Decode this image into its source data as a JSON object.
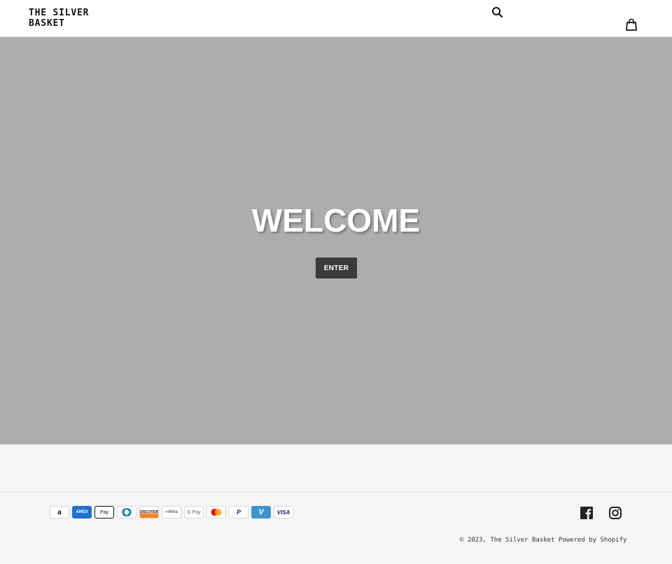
{
  "header": {
    "logo_line1": "THE SILVER",
    "logo_line2": "BASKET",
    "search_icon": "search-icon",
    "cart_icon": "cart-icon"
  },
  "hero": {
    "heading": "WELCOME",
    "button_label": "ENTER",
    "background_color": "#adadad"
  },
  "footer": {
    "payment_methods": [
      {
        "name": "amazon-icon",
        "label": "a"
      },
      {
        "name": "amex-icon",
        "label": "AMEX"
      },
      {
        "name": "apple-pay-icon",
        "label": " Pay"
      },
      {
        "name": "diners-club-icon",
        "label": "D"
      },
      {
        "name": "discover-icon",
        "label": "DISCOVER"
      },
      {
        "name": "meta-pay-icon",
        "label": "∞Meta"
      },
      {
        "name": "google-pay-icon",
        "label": "G Pay"
      },
      {
        "name": "mastercard-icon",
        "label": ""
      },
      {
        "name": "paypal-icon",
        "label": "P"
      },
      {
        "name": "venmo-icon",
        "label": "V"
      },
      {
        "name": "visa-icon",
        "label": "VISA"
      }
    ],
    "social": [
      {
        "name": "facebook-icon"
      },
      {
        "name": "instagram-icon"
      }
    ],
    "copyright_prefix": "© 2023,",
    "store_link": "The Silver Basket",
    "powered_by": "Powered by Shopify"
  }
}
